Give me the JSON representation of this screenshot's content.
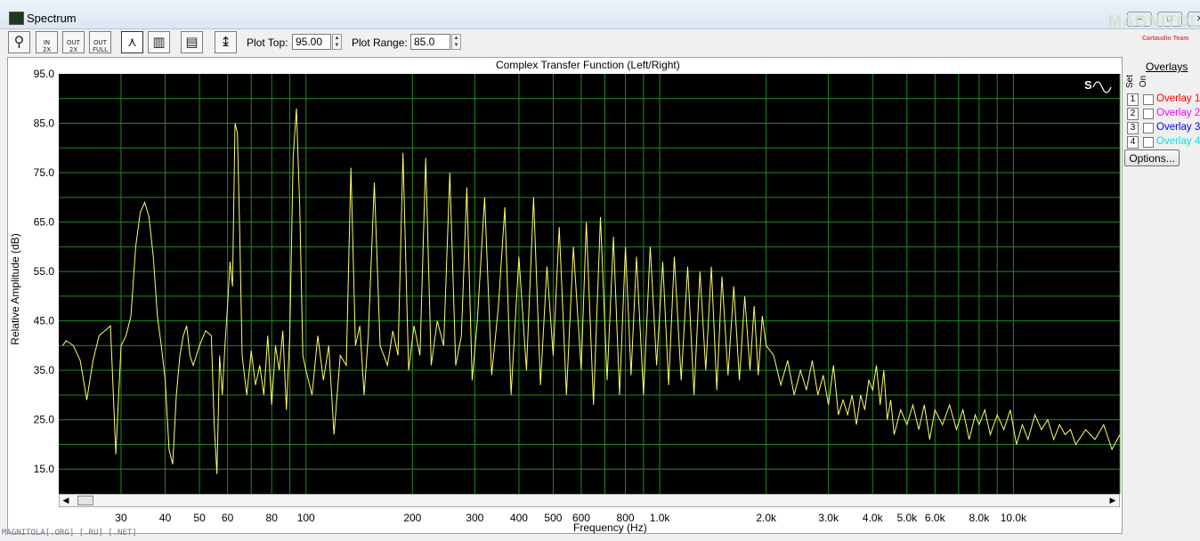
{
  "window": {
    "title": "Spectrum"
  },
  "watermark": {
    "text": "MAGNITOLA",
    "sub": "Cartaudio Team"
  },
  "toolbar": {
    "plot_top_label": "Plot Top:",
    "plot_top_value": "95.00",
    "plot_range_label": "Plot Range:",
    "plot_range_value": "85.0",
    "buttons": [
      "zoom",
      "in-2x",
      "out-2x",
      "out-full",
      "line-mode",
      "bar-mode",
      "table",
      "scale"
    ]
  },
  "overlays": {
    "header": "Overlays",
    "col_set": "Set",
    "col_on": "On",
    "items": [
      {
        "num": "1",
        "name": "Overlay 1",
        "color": "#ff0000"
      },
      {
        "num": "2",
        "name": "Overlay 2",
        "color": "#ff00ff"
      },
      {
        "num": "3",
        "name": "Overlay 3",
        "color": "#0000ff"
      },
      {
        "num": "4",
        "name": "Overlay 4",
        "color": "#00e5e5"
      }
    ],
    "options_label": "Options..."
  },
  "footer": {
    "credit": "MAGNITOLA[.ORG] [.RU] [.NET]"
  },
  "chart_data": {
    "type": "line",
    "title": "Complex Transfer Function (Left/Right)",
    "xlabel": "Frequency (Hz)",
    "ylabel": "Relative Amplitude (dB)",
    "xscale": "log",
    "xlim": [
      20,
      20000
    ],
    "ylim": [
      10,
      95
    ],
    "grid": true,
    "background": "#000000",
    "grid_color": "#1f8a1f",
    "line_color": "#ffff66",
    "x_ticks": [
      {
        "v": 30,
        "label": "30"
      },
      {
        "v": 40,
        "label": "40"
      },
      {
        "v": 50,
        "label": "50"
      },
      {
        "v": 60,
        "label": "60"
      },
      {
        "v": 80,
        "label": "80"
      },
      {
        "v": 100,
        "label": "100"
      },
      {
        "v": 200,
        "label": "200"
      },
      {
        "v": 300,
        "label": "300"
      },
      {
        "v": 400,
        "label": "400"
      },
      {
        "v": 500,
        "label": "500"
      },
      {
        "v": 600,
        "label": "600"
      },
      {
        "v": 800,
        "label": "800"
      },
      {
        "v": 1000,
        "label": "1.0k"
      },
      {
        "v": 2000,
        "label": "2.0k"
      },
      {
        "v": 3000,
        "label": "3.0k"
      },
      {
        "v": 4000,
        "label": "4.0k"
      },
      {
        "v": 5000,
        "label": "5.0k"
      },
      {
        "v": 6000,
        "label": "6.0k"
      },
      {
        "v": 8000,
        "label": "8.0k"
      },
      {
        "v": 10000,
        "label": "10.0k"
      }
    ],
    "y_ticks": [
      {
        "v": 95,
        "label": "95.0"
      },
      {
        "v": 85,
        "label": "85.0"
      },
      {
        "v": 75,
        "label": "75.0"
      },
      {
        "v": 65,
        "label": "65.0"
      },
      {
        "v": 55,
        "label": "55.0"
      },
      {
        "v": 45,
        "label": "45.0"
      },
      {
        "v": 35,
        "label": "35.0"
      },
      {
        "v": 25,
        "label": "25.0"
      },
      {
        "v": 15,
        "label": "15.0"
      }
    ],
    "series": [
      {
        "values": [
          [
            20.5,
            40
          ],
          [
            21,
            41
          ],
          [
            22,
            40
          ],
          [
            23,
            37
          ],
          [
            24,
            29
          ],
          [
            25,
            37
          ],
          [
            26,
            42
          ],
          [
            27,
            43
          ],
          [
            28,
            44
          ],
          [
            29,
            18
          ],
          [
            30,
            40
          ],
          [
            31,
            42
          ],
          [
            32,
            46
          ],
          [
            33,
            60
          ],
          [
            34,
            67
          ],
          [
            35,
            69
          ],
          [
            36,
            66
          ],
          [
            37,
            58
          ],
          [
            38,
            46
          ],
          [
            39,
            40
          ],
          [
            40,
            33
          ],
          [
            41,
            19
          ],
          [
            42,
            16
          ],
          [
            43,
            30
          ],
          [
            44,
            38
          ],
          [
            45,
            42
          ],
          [
            46,
            44
          ],
          [
            47,
            38
          ],
          [
            48,
            36
          ],
          [
            50,
            40
          ],
          [
            52,
            43
          ],
          [
            54,
            42
          ],
          [
            55,
            24
          ],
          [
            56,
            14
          ],
          [
            57,
            38
          ],
          [
            58,
            30
          ],
          [
            59,
            40
          ],
          [
            60,
            48
          ],
          [
            61,
            57
          ],
          [
            62,
            52
          ],
          [
            63,
            85
          ],
          [
            64,
            83
          ],
          [
            65,
            62
          ],
          [
            66,
            38
          ],
          [
            68,
            30
          ],
          [
            70,
            39
          ],
          [
            72,
            32
          ],
          [
            74,
            36
          ],
          [
            76,
            30
          ],
          [
            78,
            42
          ],
          [
            80,
            28
          ],
          [
            82,
            40
          ],
          [
            84,
            35
          ],
          [
            86,
            43
          ],
          [
            88,
            27
          ],
          [
            90,
            42
          ],
          [
            92,
            78
          ],
          [
            94,
            88
          ],
          [
            96,
            68
          ],
          [
            98,
            38
          ],
          [
            100,
            35
          ],
          [
            104,
            30
          ],
          [
            108,
            42
          ],
          [
            112,
            33
          ],
          [
            116,
            40
          ],
          [
            120,
            22
          ],
          [
            125,
            38
          ],
          [
            130,
            36
          ],
          [
            134,
            76
          ],
          [
            138,
            40
          ],
          [
            142,
            44
          ],
          [
            146,
            30
          ],
          [
            150,
            42
          ],
          [
            156,
            73
          ],
          [
            162,
            40
          ],
          [
            170,
            36
          ],
          [
            176,
            43
          ],
          [
            182,
            38
          ],
          [
            188,
            79
          ],
          [
            195,
            35
          ],
          [
            202,
            44
          ],
          [
            210,
            38
          ],
          [
            218,
            78
          ],
          [
            226,
            36
          ],
          [
            235,
            45
          ],
          [
            245,
            40
          ],
          [
            255,
            75
          ],
          [
            265,
            36
          ],
          [
            275,
            42
          ],
          [
            285,
            72
          ],
          [
            295,
            33
          ],
          [
            305,
            45
          ],
          [
            320,
            70
          ],
          [
            335,
            34
          ],
          [
            350,
            48
          ],
          [
            365,
            68
          ],
          [
            380,
            30
          ],
          [
            400,
            58
          ],
          [
            420,
            35
          ],
          [
            440,
            70
          ],
          [
            460,
            32
          ],
          [
            480,
            56
          ],
          [
            500,
            38
          ],
          [
            520,
            64
          ],
          [
            545,
            30
          ],
          [
            570,
            60
          ],
          [
            600,
            35
          ],
          [
            620,
            65
          ],
          [
            650,
            28
          ],
          [
            680,
            66
          ],
          [
            710,
            33
          ],
          [
            740,
            62
          ],
          [
            770,
            30
          ],
          [
            800,
            60
          ],
          [
            830,
            34
          ],
          [
            860,
            58
          ],
          [
            900,
            30
          ],
          [
            940,
            60
          ],
          [
            980,
            36
          ],
          [
            1020,
            57
          ],
          [
            1060,
            32
          ],
          [
            1100,
            58
          ],
          [
            1150,
            33
          ],
          [
            1200,
            56
          ],
          [
            1250,
            30
          ],
          [
            1300,
            55
          ],
          [
            1350,
            35
          ],
          [
            1400,
            56
          ],
          [
            1450,
            31
          ],
          [
            1500,
            54
          ],
          [
            1560,
            34
          ],
          [
            1620,
            52
          ],
          [
            1680,
            33
          ],
          [
            1740,
            50
          ],
          [
            1800,
            35
          ],
          [
            1850,
            48
          ],
          [
            1900,
            34
          ],
          [
            1950,
            46
          ],
          [
            2000,
            40
          ],
          [
            2100,
            38
          ],
          [
            2200,
            32
          ],
          [
            2300,
            37
          ],
          [
            2400,
            30
          ],
          [
            2500,
            35
          ],
          [
            2600,
            31
          ],
          [
            2700,
            37
          ],
          [
            2800,
            30
          ],
          [
            2900,
            34
          ],
          [
            3000,
            28
          ],
          [
            3100,
            36
          ],
          [
            3200,
            26
          ],
          [
            3300,
            29
          ],
          [
            3400,
            26
          ],
          [
            3500,
            30
          ],
          [
            3600,
            24
          ],
          [
            3700,
            30
          ],
          [
            3800,
            27
          ],
          [
            3900,
            33
          ],
          [
            4000,
            31
          ],
          [
            4100,
            36
          ],
          [
            4200,
            28
          ],
          [
            4300,
            35
          ],
          [
            4400,
            25
          ],
          [
            4500,
            29
          ],
          [
            4600,
            22
          ],
          [
            4800,
            27
          ],
          [
            5000,
            24
          ],
          [
            5200,
            28
          ],
          [
            5400,
            23
          ],
          [
            5600,
            28
          ],
          [
            5800,
            21
          ],
          [
            6000,
            27
          ],
          [
            6300,
            24
          ],
          [
            6600,
            28
          ],
          [
            6900,
            23
          ],
          [
            7200,
            27
          ],
          [
            7500,
            21
          ],
          [
            7800,
            26
          ],
          [
            8000,
            24
          ],
          [
            8300,
            27
          ],
          [
            8600,
            22
          ],
          [
            9000,
            26
          ],
          [
            9400,
            23
          ],
          [
            9800,
            27
          ],
          [
            10200,
            20
          ],
          [
            10600,
            24
          ],
          [
            11000,
            21
          ],
          [
            11500,
            26
          ],
          [
            12000,
            23
          ],
          [
            12500,
            25
          ],
          [
            13000,
            21
          ],
          [
            13500,
            24
          ],
          [
            14000,
            22
          ],
          [
            14500,
            23
          ],
          [
            15000,
            20
          ],
          [
            16000,
            23
          ],
          [
            17000,
            21
          ],
          [
            18000,
            24
          ],
          [
            19000,
            19
          ],
          [
            20000,
            22
          ]
        ]
      }
    ]
  }
}
